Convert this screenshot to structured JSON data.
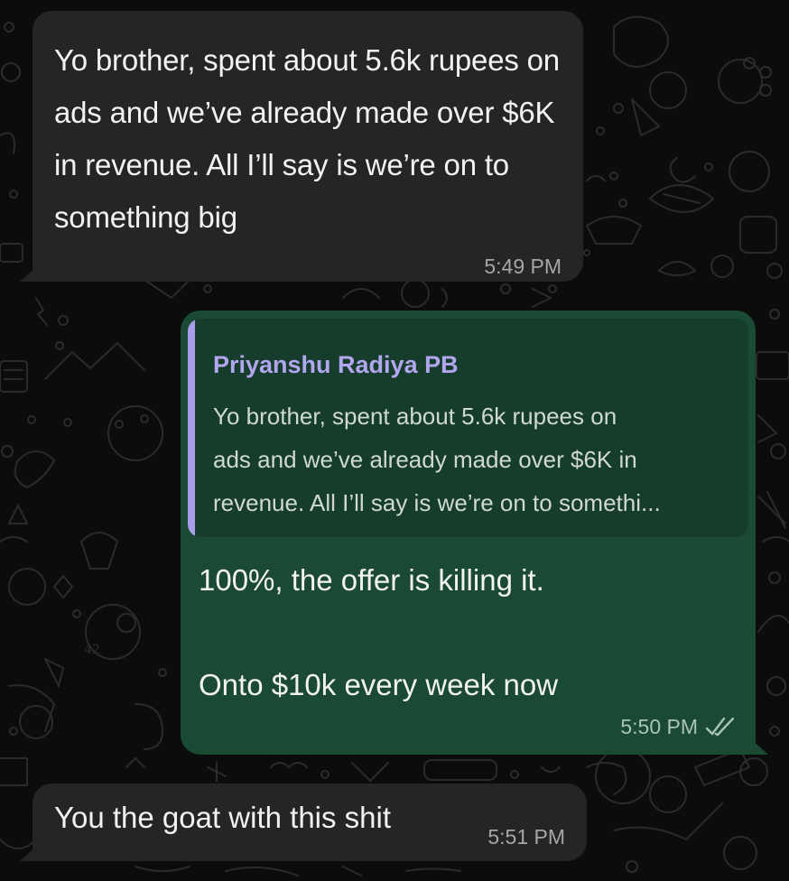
{
  "chat": {
    "messages": [
      {
        "direction": "incoming",
        "text": "Yo brother, spent about 5.6k rupees on ads and we’ve already made over $6K in revenue. All I’ll say is we’re on to something big",
        "time": "5:49 PM"
      },
      {
        "direction": "outgoing",
        "reply_to": {
          "author": "Priyanshu Radiya PB",
          "preview": "Yo brother, spent about 5.6k rupees on\nads and we’ve already made over $6K in\nrevenue. All I’ll say is we’re on to somethi..."
        },
        "text": "100%, the offer is killing it.\n\nOnto $10k every week now",
        "time": "5:50 PM",
        "status_icon": "double-check-icon"
      },
      {
        "direction": "incoming",
        "text": "You the goat with this shit",
        "time": "5:51 PM"
      }
    ]
  },
  "colors": {
    "background": "#0b0c0c",
    "incoming_bubble": "#252526",
    "outgoing_bubble": "#1b4a34",
    "quote_bar": "#a99de9",
    "quote_author": "#b2a6ef"
  }
}
